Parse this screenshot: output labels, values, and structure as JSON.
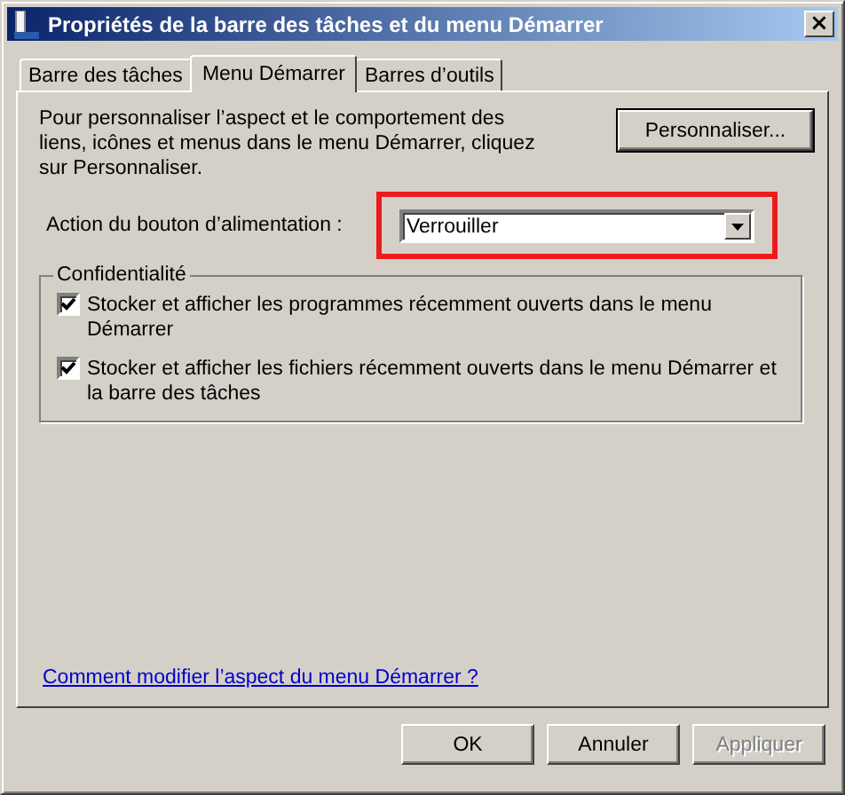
{
  "window": {
    "title": "Propriétés de la barre des tâches et du menu Démarrer",
    "close": "×"
  },
  "tabs": [
    {
      "label": "Barre des tâches",
      "selected": false
    },
    {
      "label": "Menu Démarrer",
      "selected": true
    },
    {
      "label": "Barres d’outils",
      "selected": false
    }
  ],
  "intro": "Pour personnaliser l’aspect et le comportement des liens, icônes et menus dans le menu Démarrer, cliquez sur Personnaliser.",
  "customize_button": "Personnaliser...",
  "power_action": {
    "label": "Action du bouton d’alimentation :",
    "value": "Verrouiller",
    "highlighted": true
  },
  "privacy": {
    "title": "Confidentialité",
    "options": [
      {
        "label": "Stocker et afficher les programmes récemment ouverts dans le menu Démarrer",
        "checked": true
      },
      {
        "label": "Stocker et afficher les fichiers récemment ouverts dans le menu Démarrer et la barre des tâches",
        "checked": true
      }
    ]
  },
  "help_link": "Comment modifier l’aspect du menu Démarrer ?",
  "buttons": [
    {
      "label": "OK",
      "disabled": false
    },
    {
      "label": "Annuler",
      "disabled": false
    },
    {
      "label": "Appliquer",
      "disabled": true
    }
  ]
}
